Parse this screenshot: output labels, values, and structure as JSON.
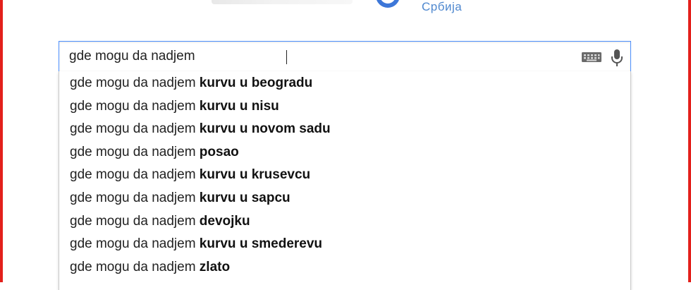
{
  "header": {
    "country_label": "Србија",
    "logo_icon": "google-logo-icon"
  },
  "search": {
    "value": "gde mogu da nadjem",
    "keyboard_icon": "keyboard-icon",
    "mic_icon": "microphone-icon"
  },
  "suggestions": [
    {
      "prefix": "gde mogu da nadjem",
      "completion": "kurvu u beogradu"
    },
    {
      "prefix": "gde mogu da nadjem",
      "completion": "kurvu u nisu"
    },
    {
      "prefix": "gde mogu da nadjem",
      "completion": "kurvu u novom sadu"
    },
    {
      "prefix": "gde mogu da nadjem",
      "completion": "posao"
    },
    {
      "prefix": "gde mogu da nadjem",
      "completion": "kurvu u krusevcu"
    },
    {
      "prefix": "gde mogu da nadjem",
      "completion": "kurvu u sapcu"
    },
    {
      "prefix": "gde mogu da nadjem",
      "completion": "devojku"
    },
    {
      "prefix": "gde mogu da nadjem",
      "completion": "kurvu u smederevu"
    },
    {
      "prefix": "gde mogu da nadjem",
      "completion": "zlato"
    }
  ],
  "colors": {
    "frame_border": "#e3201b",
    "input_border": "#4d90fe",
    "country_label": "#4f88cf"
  }
}
